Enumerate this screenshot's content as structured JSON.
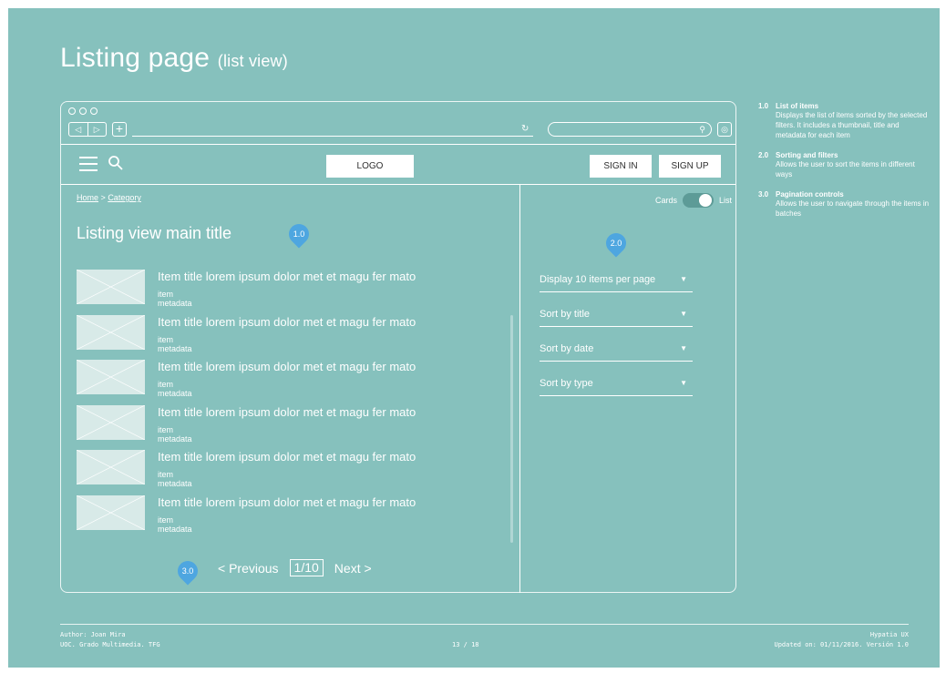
{
  "page_title": "Listing page",
  "page_title_sub": "(list view)",
  "browser": {
    "back": "◁",
    "forward": "▷",
    "new_tab": "+",
    "reload": "↻",
    "search_icon": "⚲",
    "options_icon": "◎"
  },
  "header": {
    "logo": "LOGO",
    "sign_in": "SIGN IN",
    "sign_up": "SIGN UP"
  },
  "breadcrumb": {
    "home": "Home",
    "sep": ">",
    "category": "Category"
  },
  "main_title": "Listing view main title",
  "markers": {
    "list": "1.0",
    "filters": "2.0",
    "pagination": "3.0"
  },
  "items": [
    {
      "title": "Item title lorem ipsum dolor met et magu fer mato",
      "meta": "item metadata"
    },
    {
      "title": "Item title lorem ipsum dolor met et magu fer mato",
      "meta": "item metadata"
    },
    {
      "title": "Item title lorem ipsum dolor met et magu fer mato",
      "meta": "item metadata"
    },
    {
      "title": "Item title lorem ipsum dolor met et magu fer mato",
      "meta": "item metadata"
    },
    {
      "title": "Item title lorem ipsum dolor met et magu fer mato",
      "meta": "item metadata"
    },
    {
      "title": "Item title lorem ipsum dolor met et magu fer mato",
      "meta": "item metadata"
    }
  ],
  "pagination": {
    "previous": "< Previous",
    "page": "1/10",
    "next": "Next >"
  },
  "view_toggle": {
    "left": "Cards",
    "right": "List"
  },
  "filters": [
    "Display 10 items per page",
    "Sort by title",
    "Sort by date",
    "Sort by type"
  ],
  "notes": [
    {
      "num": "1.0",
      "head": "List of items",
      "desc": "Displays the list of items  sorted by the selected filters. It includes a thumbnail, title and metadata for each item"
    },
    {
      "num": "2.0",
      "head": "Sorting and filters",
      "desc": "Allows the user to sort the items in different ways"
    },
    {
      "num": "3.0",
      "head": "Pagination controls",
      "desc": "Allows the user to navigate through the items in batches"
    }
  ],
  "footer": {
    "author": "Author: Joan Mira",
    "org": "UOC. Grado Multimedia. TFG",
    "page": "13 / 18",
    "brand": "Hypatia UX",
    "updated": "Updated on: 01/11/2016. Versión 1.0"
  },
  "colors": {
    "background": "#86c1bd",
    "marker": "#4ea6e0"
  }
}
